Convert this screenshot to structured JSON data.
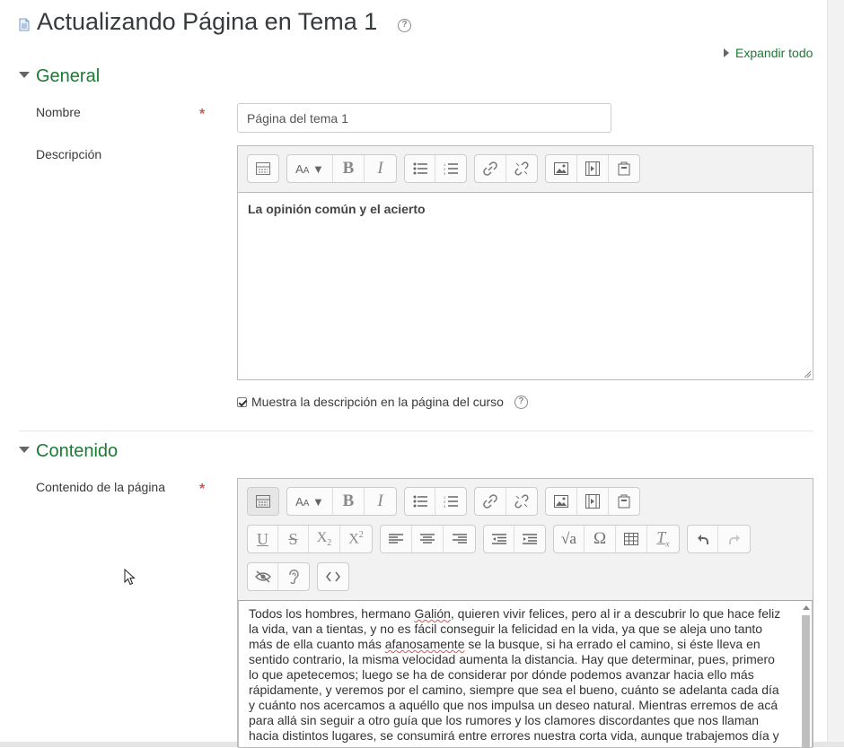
{
  "header": {
    "title": "Actualizando Página en Tema 1",
    "expand_all": "Expandir todo"
  },
  "sections": {
    "general": "General",
    "content": "Contenido"
  },
  "fields": {
    "name_label": "Nombre",
    "name_value": "Página del tema 1",
    "description_label": "Descripción",
    "description_text": "La opinión común y el acierto",
    "show_description_label": "Muestra la descripción en la página del curso",
    "show_description_checked": true,
    "page_content_label": "Contenido de la página",
    "required_marker": "*"
  },
  "page_content_text": {
    "before_name": "Todos los hombres, hermano ",
    "name": "Galión",
    "middle": ", quieren vivir felices, pero al ir a descubrir lo que hace feliz la vida, van a tientas, y no es fácil conseguir la felicidad en la vida, ya que se aleja uno tanto más de ella cuanto más ",
    "misspelled": "afanosamente",
    "after": " se la busque, si ha errado el camino, si éste lleva en sentido contrario, la misma velocidad aumenta la distancia. Hay que determinar, pues, primero lo que apetecemos; luego se ha de considerar por dónde podemos avanzar hacia ello más rápidamente, y veremos por el camino, siempre que sea el bueno, cuánto se adelanta cada día y cuánto nos acercamos a aquéllo que nos impulsa un deseo natural. Mientras erremos de acá para allá sin seguir a otro guía que los rumores y los clamores discordantes que nos llaman hacia distintos lugares, se consumirá entre errores nuestra corta vida, aunque trabajemos día y"
  },
  "toolbar_icons": {
    "row1": [
      "toolbar-toggle-icon",
      "font-style-icon",
      "bold-icon",
      "italic-icon",
      "unordered-list-icon",
      "ordered-list-icon",
      "link-icon",
      "unlink-icon",
      "image-icon",
      "media-icon",
      "file-icon"
    ],
    "row2": [
      "underline-icon",
      "strikethrough-icon",
      "subscript-icon",
      "superscript-icon",
      "align-left-icon",
      "align-center-icon",
      "align-right-icon",
      "outdent-icon",
      "indent-icon",
      "equation-icon",
      "special-char-icon",
      "table-icon",
      "clear-format-icon",
      "undo-icon",
      "redo-icon"
    ],
    "row3": [
      "accessibility-checker-icon",
      "screenreader-helper-icon",
      "html-code-icon"
    ]
  },
  "colors": {
    "accent_green": "#1b7a34",
    "required_red": "#d9534f"
  }
}
